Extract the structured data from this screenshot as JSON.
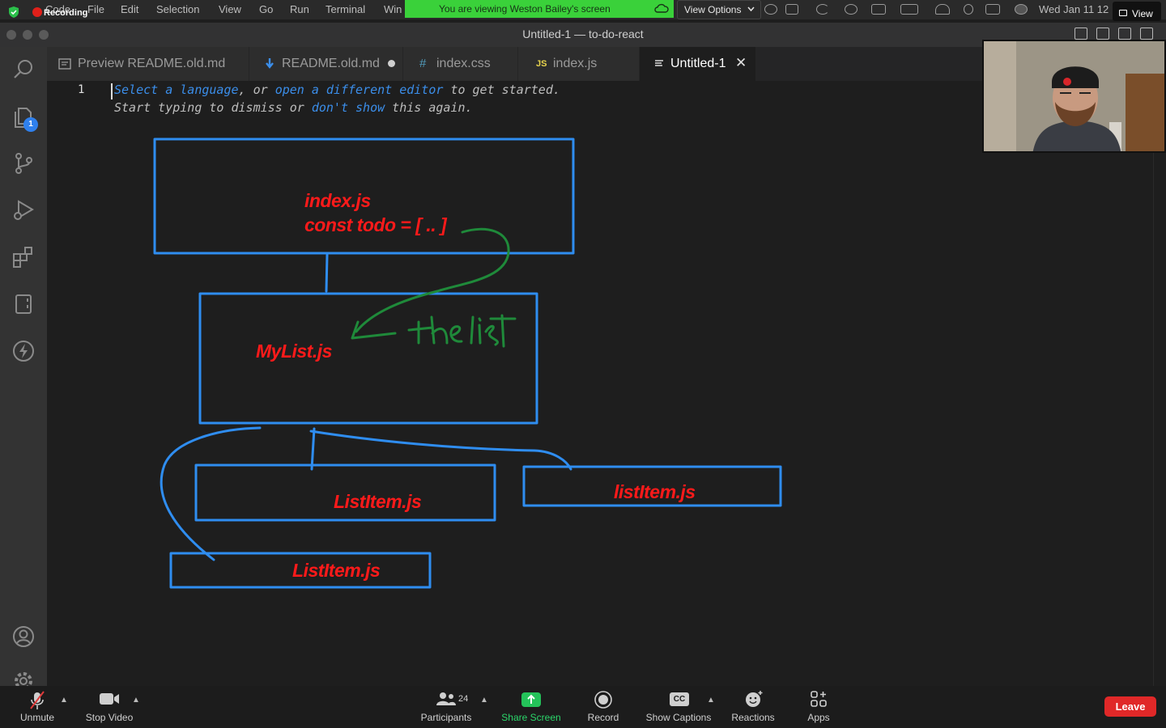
{
  "menubar": {
    "recording_label": "Recording",
    "app_menu": "Code",
    "items": [
      "File",
      "Edit",
      "Selection",
      "View",
      "Go",
      "Run",
      "Terminal",
      "Win"
    ],
    "share_banner": "You are viewing Weston Bailey's screen",
    "view_options": "View Options",
    "datetime": "Wed Jan 11  12",
    "view_button": "View"
  },
  "window": {
    "title": "Untitled-1 — to-do-react"
  },
  "tabs": [
    {
      "label": "Preview README.old.md",
      "icon": "preview-icon",
      "active": false
    },
    {
      "label": "README.old.md",
      "icon": "markdown-icon",
      "modified": true,
      "active": false
    },
    {
      "label": "index.css",
      "icon": "css-hash-icon",
      "icon_text": "#",
      "active": false
    },
    {
      "label": "index.js",
      "icon": "js-icon",
      "icon_text": "JS",
      "active": false
    },
    {
      "label": "Untitled-1",
      "icon": "text-file-icon",
      "active": true
    }
  ],
  "activity": {
    "explorer_badge": "1"
  },
  "editor": {
    "line_number": "1",
    "hint_line1": {
      "a": "Select a language",
      "b": ", or ",
      "c": "open a different editor",
      "d": " to get started."
    },
    "hint_line2": {
      "a": "Start typing to dismiss or ",
      "b": "don't show",
      "c": " this again."
    }
  },
  "drawing": {
    "index_box": {
      "line1": "index.js",
      "line2": "const todo = [ .. ]"
    },
    "mylist_box": "MyList.js",
    "listitem_a": "ListItem.js",
    "listitem_b": "listItem.js",
    "listitem_c": "ListItem.js",
    "handwritten_annotation": "the list",
    "colors": {
      "box": "#2f8df0",
      "label": "#ff1a1a",
      "arrow": "#1f8a3a"
    }
  },
  "zoom": {
    "unmute": "Unmute",
    "stop_video": "Stop Video",
    "participants": "Participants",
    "participant_count": "24",
    "share_screen": "Share Screen",
    "record": "Record",
    "show_captions": "Show Captions",
    "captions_icon": "CC",
    "reactions": "Reactions",
    "apps": "Apps",
    "leave": "Leave"
  }
}
